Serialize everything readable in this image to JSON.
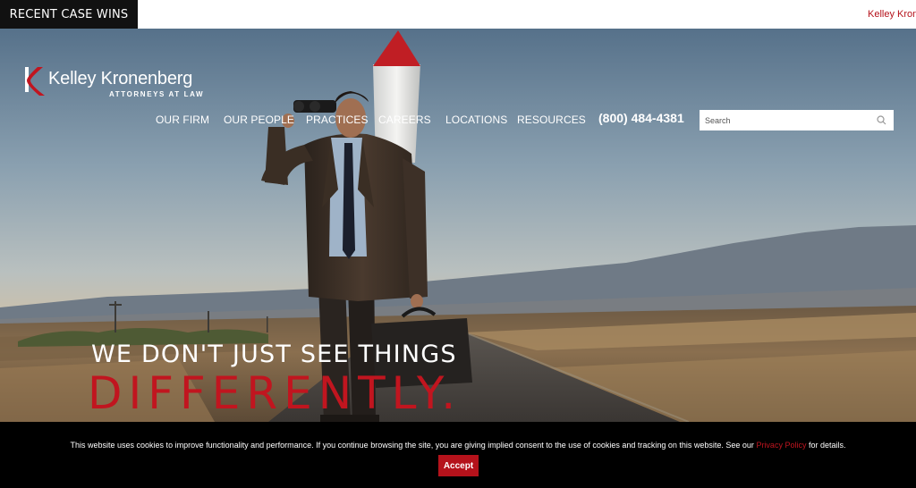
{
  "ticker": {
    "label": "RECENT CASE WINS",
    "text": "Kelley Kronenberg"
  },
  "logo": {
    "name": "Kelley Kronenberg",
    "subtitle": "ATTORNEYS AT LAW"
  },
  "nav": {
    "items": [
      {
        "label": "OUR FIRM"
      },
      {
        "label": "OUR PEOPLE"
      },
      {
        "label": "PRACTICES"
      },
      {
        "label": "CAREERS"
      },
      {
        "label": "LOCATIONS"
      },
      {
        "label": "RESOURCES"
      }
    ],
    "phone": "(800) 484-4381"
  },
  "search": {
    "placeholder": "Search",
    "value": ""
  },
  "hero": {
    "headline_line1": "WE DON'T JUST SEE THINGS",
    "headline_line2": "DIFFERENTLY."
  },
  "cookie": {
    "text_before": "This website uses cookies to improve functionality and performance. If you continue browsing the site, you are giving implied consent to the use of cookies and tracking on this website. See our ",
    "link_text": "Privacy Policy",
    "text_after": " for details.",
    "accept_label": "Accept"
  },
  "colors": {
    "brand_red": "#c1151f",
    "ticker_bg": "#111111",
    "cookie_bg": "#000000"
  }
}
